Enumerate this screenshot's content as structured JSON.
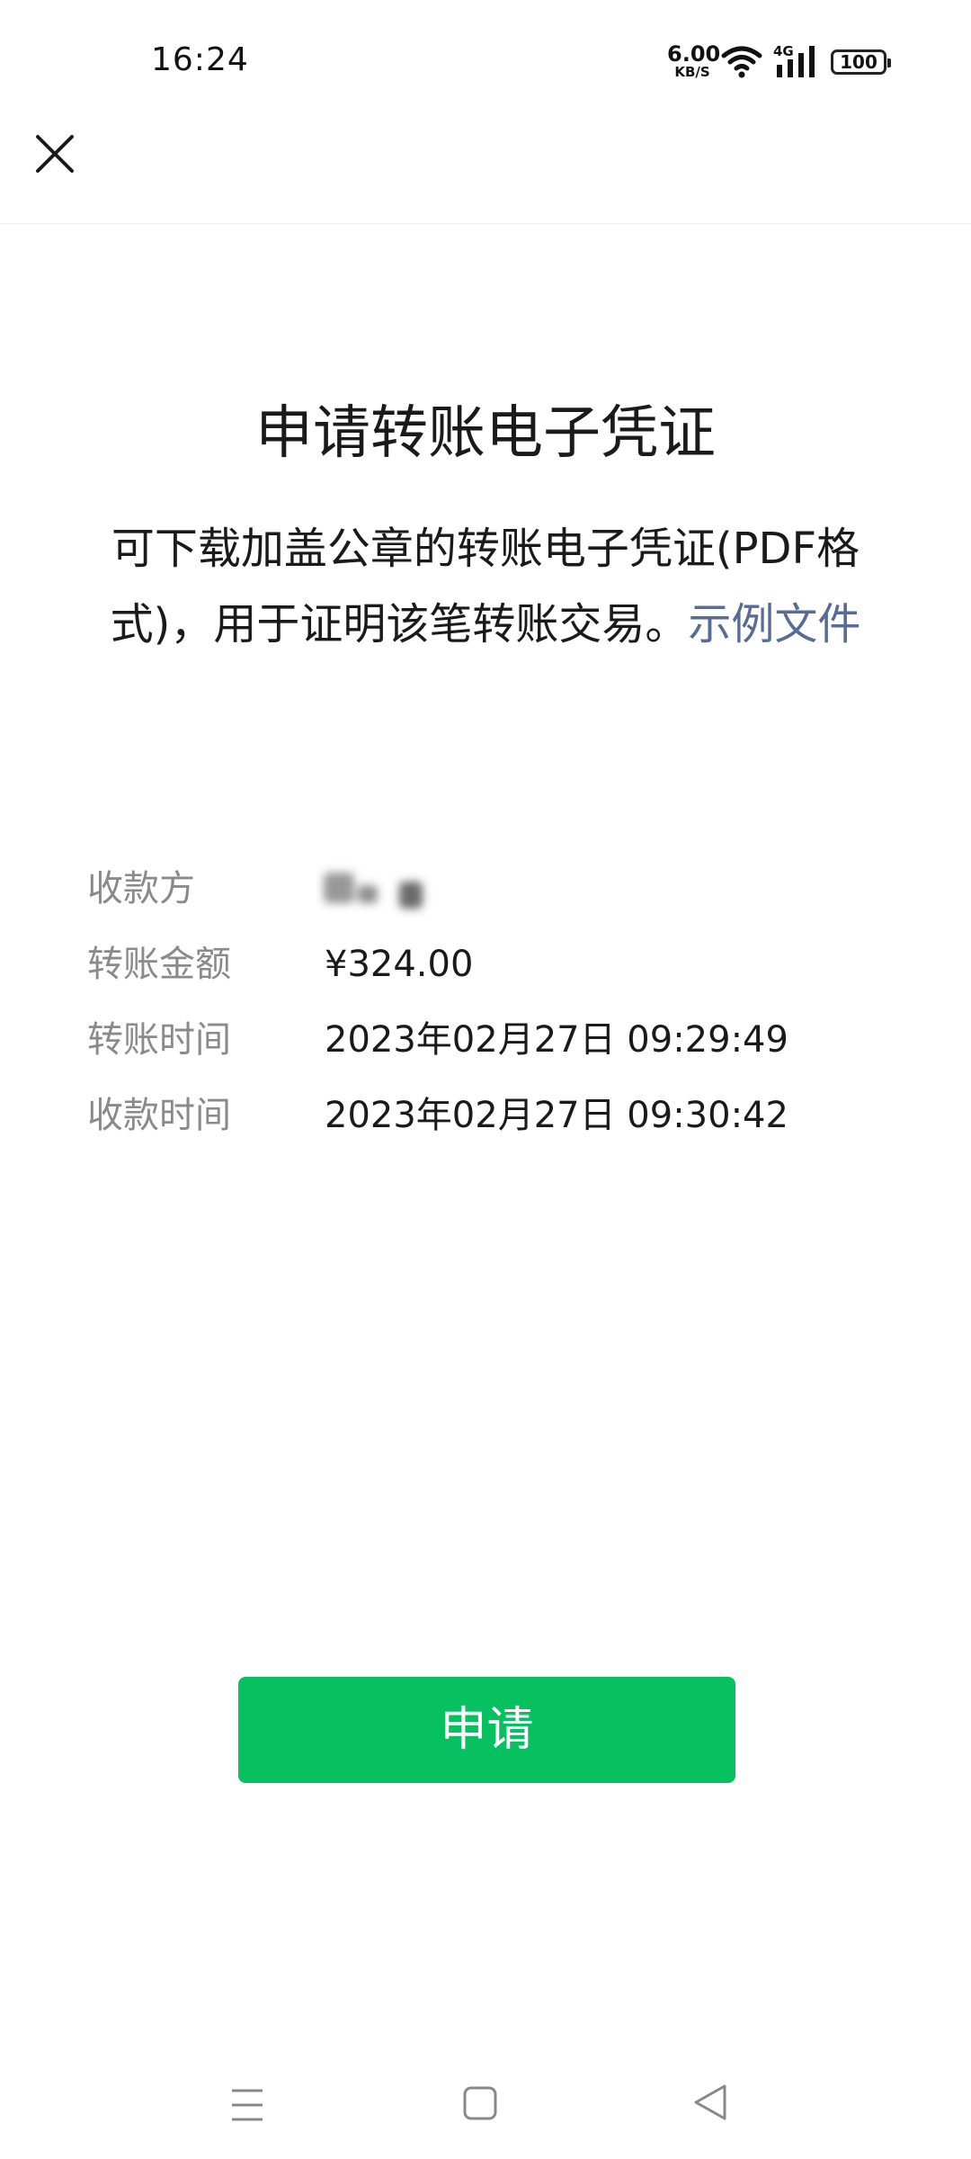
{
  "status_bar": {
    "time": "16:24",
    "net_speed_value": "6.00",
    "net_speed_unit": "KB/S",
    "network_type": "4G",
    "battery": "100"
  },
  "header": {
    "close_icon": "close-icon"
  },
  "main": {
    "title": "申请转账电子凭证",
    "description": "可下载加盖公章的转账电子凭证(PDF格式)，用于证明该笔转账交易。",
    "example_link": "示例文件",
    "rows": [
      {
        "label": "收款方",
        "value": ""
      },
      {
        "label": "转账金额",
        "value": "¥324.00"
      },
      {
        "label": "转账时间",
        "value": "2023年02月27日 09:29:49"
      },
      {
        "label": "收款时间",
        "value": "2023年02月27日 09:30:42"
      }
    ]
  },
  "apply_button": "申请",
  "nav": {
    "menu_icon": "menu-icon",
    "home_icon": "home-icon",
    "back_icon": "back-icon"
  },
  "colors": {
    "accent_green": "#07c160",
    "link_blue": "#576b95",
    "label_gray": "#8a8a8a"
  }
}
